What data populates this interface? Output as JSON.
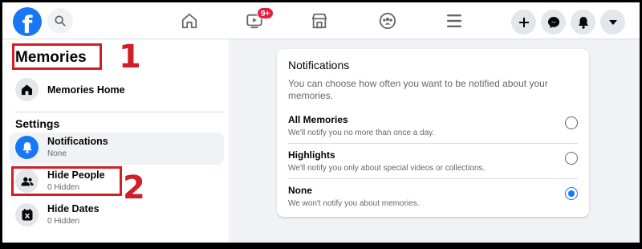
{
  "topbar": {
    "logo": "f",
    "search_icon": "search-icon",
    "watch_badge": "9+",
    "icons": [
      "home-icon",
      "watch-icon",
      "marketplace-icon",
      "groups-icon",
      "menu-icon",
      "create-icon",
      "messenger-icon",
      "notifications-icon",
      "account-caret-icon"
    ]
  },
  "sidebar": {
    "title": "Memories",
    "home_label": "Memories Home",
    "settings_heading": "Settings",
    "items": [
      {
        "label": "Notifications",
        "sub": "None",
        "icon": "bell-icon"
      },
      {
        "label": "Hide People",
        "sub": "0 Hidden",
        "icon": "people-icon"
      },
      {
        "label": "Hide Dates",
        "sub": "0 Hidden",
        "icon": "calendar-x-icon"
      }
    ]
  },
  "annotations": {
    "one": "1",
    "two": "2",
    "color": "#d11e27"
  },
  "main": {
    "card_title": "Notifications",
    "card_desc": "You can choose how often you want to be notified about your memories.",
    "options": [
      {
        "label": "All Memories",
        "desc": "We'll notify you no more than once a day.",
        "selected": false
      },
      {
        "label": "Highlights",
        "desc": "We'll notify you only about special videos or collections.",
        "selected": false
      },
      {
        "label": "None",
        "desc": "We won't notify you about memories.",
        "selected": true
      }
    ]
  },
  "colors": {
    "accent": "#1877f2",
    "badge": "#e41e3f",
    "background": "#f0f2f5"
  }
}
